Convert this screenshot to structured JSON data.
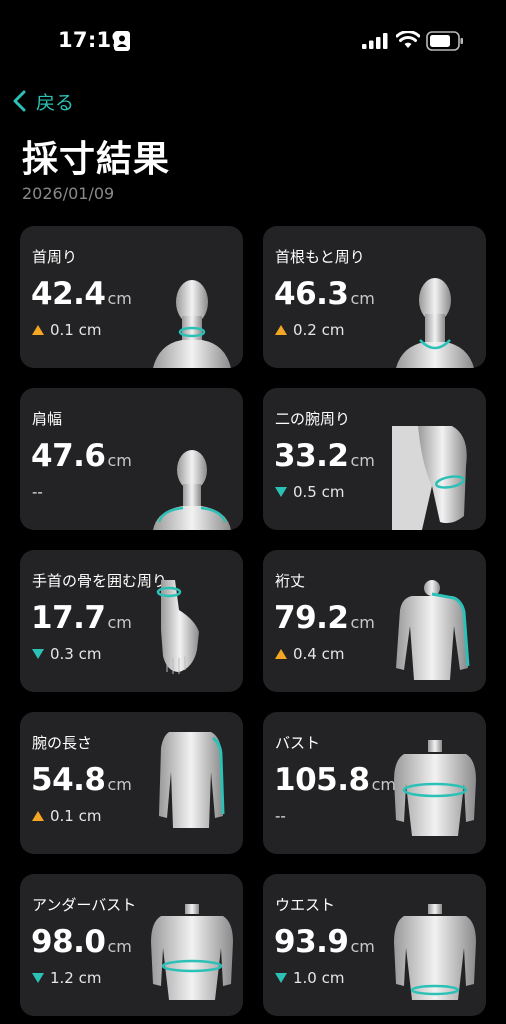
{
  "status": {
    "time": "17:19"
  },
  "nav": {
    "back_label": "戻る"
  },
  "header": {
    "title": "採寸結果",
    "date": "2026/01/09"
  },
  "colors": {
    "accent": "#2cc1b7",
    "increase": "#f5a623",
    "decrease": "#2cc1b7",
    "card_bg": "#232325"
  },
  "cards": [
    {
      "label": "首周り",
      "value": "42.4",
      "unit": "cm",
      "change": "0.1 cm",
      "direction": "up",
      "icon": "neck-illustration"
    },
    {
      "label": "首根もと周り",
      "value": "46.3",
      "unit": "cm",
      "change": "0.2 cm",
      "direction": "up",
      "icon": "neck-base-illustration"
    },
    {
      "label": "肩幅",
      "value": "47.6",
      "unit": "cm",
      "change": "--",
      "direction": "none",
      "icon": "shoulder-illustration"
    },
    {
      "label": "二の腕周り",
      "value": "33.2",
      "unit": "cm",
      "change": "0.5 cm",
      "direction": "down",
      "icon": "upper-arm-illustration"
    },
    {
      "label": "手首の骨を囲む周り",
      "value": "17.7",
      "unit": "cm",
      "change": "0.3 cm",
      "direction": "down",
      "icon": "wrist-illustration"
    },
    {
      "label": "裄丈",
      "value": "79.2",
      "unit": "cm",
      "change": "0.4 cm",
      "direction": "up",
      "icon": "sleeve-length-illustration"
    },
    {
      "label": "腕の長さ",
      "value": "54.8",
      "unit": "cm",
      "change": "0.1 cm",
      "direction": "up",
      "icon": "arm-length-illustration"
    },
    {
      "label": "バスト",
      "value": "105.8",
      "unit": "cm",
      "change": "--",
      "direction": "none",
      "icon": "bust-illustration"
    },
    {
      "label": "アンダーバスト",
      "value": "98.0",
      "unit": "cm",
      "change": "1.2 cm",
      "direction": "down",
      "icon": "underbust-illustration"
    },
    {
      "label": "ウエスト",
      "value": "93.9",
      "unit": "cm",
      "change": "1.0 cm",
      "direction": "down",
      "icon": "waist-illustration"
    }
  ]
}
